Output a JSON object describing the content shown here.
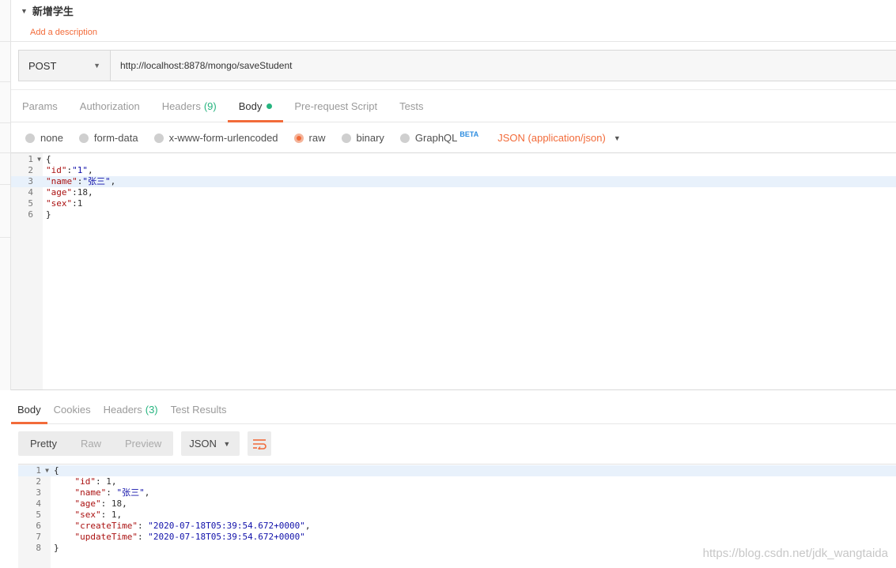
{
  "request": {
    "title": "新增学生",
    "add_description": "Add a description",
    "method": "POST",
    "url": "http://localhost:8878/mongo/saveStudent"
  },
  "request_tabs": [
    {
      "label": "Params",
      "count": ""
    },
    {
      "label": "Authorization",
      "count": ""
    },
    {
      "label": "Headers",
      "count": "(9)"
    },
    {
      "label": "Body",
      "count": ""
    },
    {
      "label": "Pre-request Script",
      "count": ""
    },
    {
      "label": "Tests",
      "count": ""
    }
  ],
  "body_types": {
    "none": "none",
    "form_data": "form-data",
    "urlencoded": "x-www-form-urlencoded",
    "raw": "raw",
    "binary": "binary",
    "graphql": "GraphQL",
    "beta": "BETA",
    "content_type": "JSON (application/json)"
  },
  "request_body": {
    "line_numbers": [
      "1",
      "2",
      "3",
      "4",
      "5",
      "6"
    ],
    "l1": "{",
    "l2_key": "\"id\"",
    "l2_val": "\"1\"",
    "l3_key": "\"name\"",
    "l3_val": "\"张三\"",
    "l4_key": "\"age\"",
    "l4_val": "18",
    "l5_key": "\"sex\"",
    "l5_val": "1",
    "l6": "}"
  },
  "response_tabs": [
    {
      "label": "Body",
      "count": ""
    },
    {
      "label": "Cookies",
      "count": ""
    },
    {
      "label": "Headers",
      "count": "(3)"
    },
    {
      "label": "Test Results",
      "count": ""
    }
  ],
  "response_toolbar": {
    "pretty": "Pretty",
    "raw": "Raw",
    "preview": "Preview",
    "format": "JSON"
  },
  "response_body": {
    "line_numbers": [
      "1",
      "2",
      "3",
      "4",
      "5",
      "6",
      "7",
      "8"
    ],
    "l1": "{",
    "l2_key": "\"id\"",
    "l2_val": "1",
    "l3_key": "\"name\"",
    "l3_val": "\"张三\"",
    "l4_key": "\"age\"",
    "l4_val": "18",
    "l5_key": "\"sex\"",
    "l5_val": "1",
    "l6_key": "\"createTime\"",
    "l6_val": "\"2020-07-18T05:39:54.672+0000\"",
    "l7_key": "\"updateTime\"",
    "l7_val": "\"2020-07-18T05:39:54.672+0000\"",
    "l8": "}"
  },
  "watermark": "https://blog.csdn.net/jdk_wangtaida",
  "colors": {
    "accent": "#f26b3a",
    "success": "#26b47f",
    "beta": "#2f8ee0"
  }
}
